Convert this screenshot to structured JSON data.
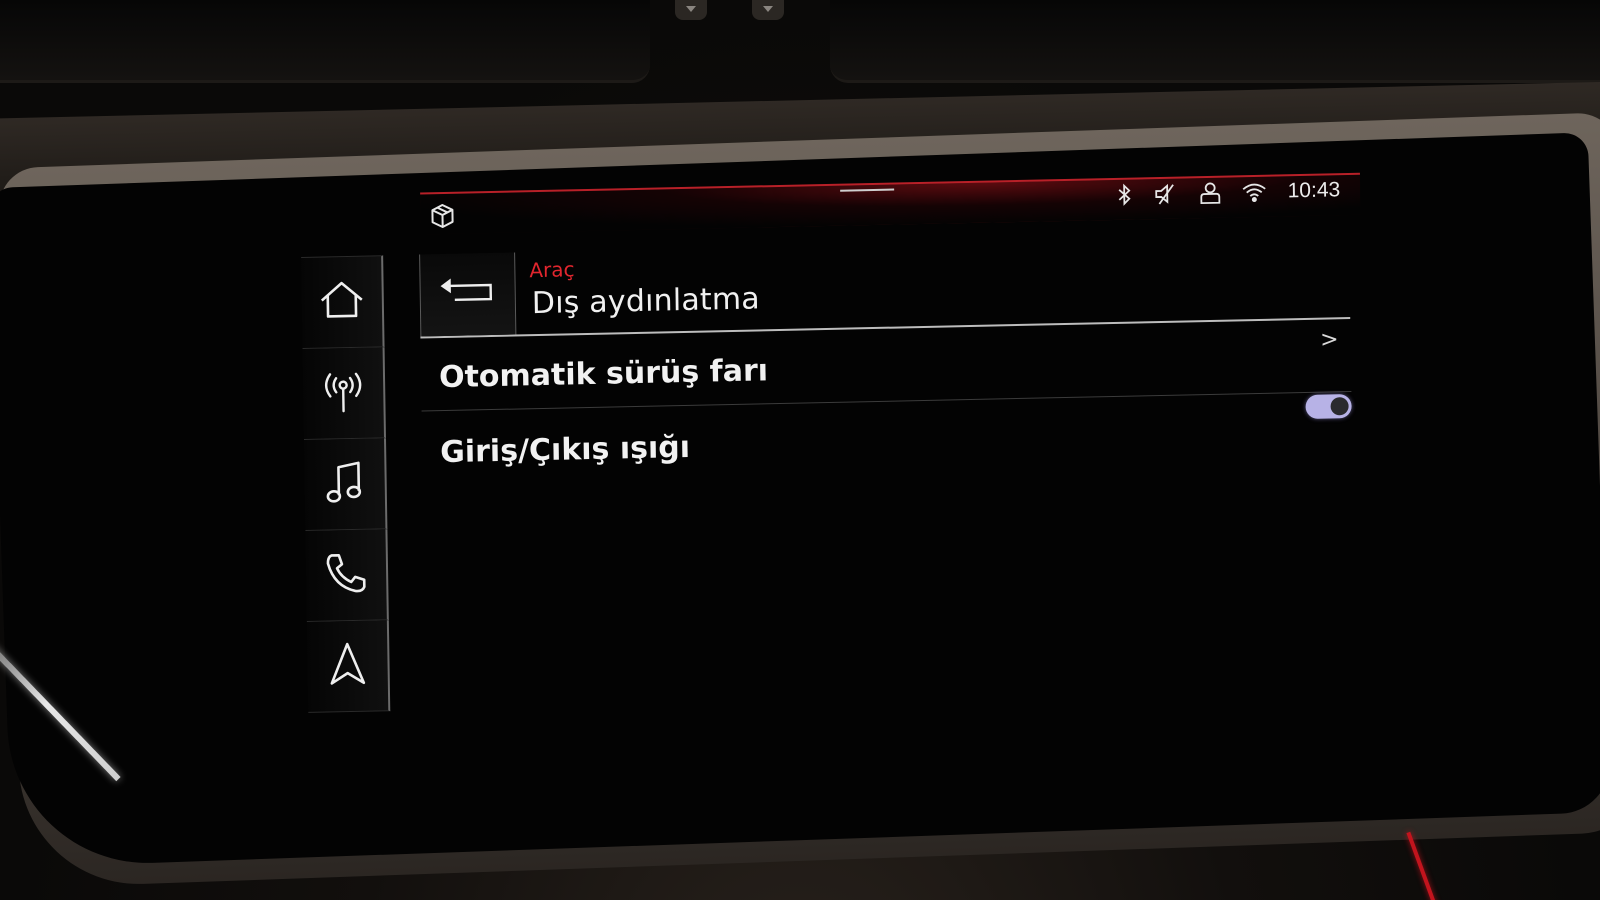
{
  "status_bar": {
    "time": "10:43",
    "icons": [
      "bluetooth-icon",
      "mute-icon",
      "user-profile-icon",
      "wifi-icon"
    ]
  },
  "app_icon": "cube-icon",
  "sidebar": {
    "items": [
      {
        "name": "home",
        "icon": "home-icon"
      },
      {
        "name": "radio",
        "icon": "radio-antenna-icon"
      },
      {
        "name": "media",
        "icon": "music-note-icon"
      },
      {
        "name": "phone",
        "icon": "phone-icon"
      },
      {
        "name": "navigation",
        "icon": "navigation-arrow-icon"
      }
    ]
  },
  "header": {
    "breadcrumb": "Araç",
    "title": "Dış aydınlatma"
  },
  "list": {
    "items": [
      {
        "label": "Otomatik sürüş farı",
        "control": "chevron",
        "chevron": ">"
      },
      {
        "label": "Giriş/Çıkış ışığı",
        "control": "toggle",
        "toggle_on": true
      }
    ]
  },
  "colors": {
    "accent_red": "#e2262e",
    "toggle_on": "#b7b2e6",
    "text": "#f2f2f2"
  }
}
